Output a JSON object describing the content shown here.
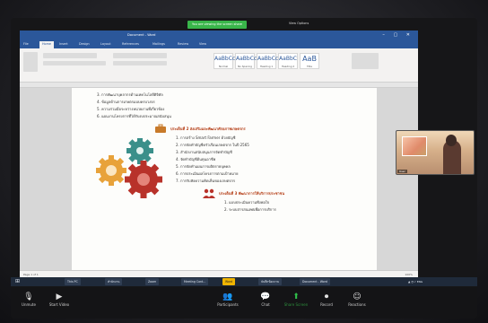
{
  "zoom": {
    "banner": "You are viewing the screen share",
    "view_options": "View Options",
    "controls": {
      "participants": "Participants",
      "chat": "Chat",
      "share_screen": "Share Screen",
      "record": "Record",
      "reactions": "Reactions",
      "unmute": "Unmute",
      "start_video": "Start Video"
    }
  },
  "word": {
    "title": "Document - Word",
    "tabs": [
      "File",
      "Home",
      "Insert",
      "Design",
      "Layout",
      "References",
      "Mailings",
      "Review",
      "View"
    ],
    "active_tab": "Home",
    "styles": [
      {
        "sample": "AaBbCc",
        "name": "Normal"
      },
      {
        "sample": "AaBbCc",
        "name": "No Spacing"
      },
      {
        "sample": "AaBbCc",
        "name": "Heading 1"
      },
      {
        "sample": "AaBbC",
        "name": "Heading 2"
      },
      {
        "sample": "AaB",
        "name": "Title"
      }
    ],
    "status_left": "Page 1 of 1",
    "zoom_level": "100%"
  },
  "document": {
    "top_items": [
      "3. การพัฒนาบุคลากรด้านเทคโนโลยีดิจิทัล",
      "4. ข้อมูลด้านการเกษตรแบบครบวงจร",
      "5. ความร่วมมือระหว่างหน่วยงานที่เกี่ยวข้อง",
      "6. แผนงานโครงการที่ได้รับงบประมาณสนับสนุน"
    ],
    "heading_1": "ประเด็นที่ 2 ส่งเสริมและพัฒนาศักยภาพเกษตรกร",
    "items_1": [
      "1. การสร้าง Smart Farmer ด้วยบัญชี",
      "2. การจัดทำบัญชีครัวเรือนเกษตรกร ในปี 2565",
      "3. สำนักงานสนับสนุนการจัดทำบัญชี",
      "4. จัดทำบัญชีต้นทุนอาชีพ",
      "5. การจัดทำแผนการผลิตรายบุคคล",
      "6. การประเมินผลโครงการตามเป้าหมาย",
      "7. การรับฟังความคิดเห็นของเกษตรกร"
    ],
    "heading_2": "ประเด็นที่ 3 พัฒนาการให้บริการประชาชน",
    "items_2": [
      "1. แบบประเมินความพึงพอใจ",
      "2. ระบบสารสนเทศเพื่อการบริการ"
    ]
  },
  "taskbar": [
    "This PC",
    "สำนักงาน",
    "Zoom",
    "Meeting Cont...",
    "Word",
    "บันทึกข้อความ",
    "Document - Word"
  ],
  "camera": {
    "label": "User"
  },
  "colors": {
    "word_blue": "#2b579a",
    "heading": "#b43c14",
    "zoom_green": "#39b54a",
    "gear_teal": "#3a8f8a",
    "gear_orange": "#e8a23a",
    "gear_red": "#b8322a"
  }
}
